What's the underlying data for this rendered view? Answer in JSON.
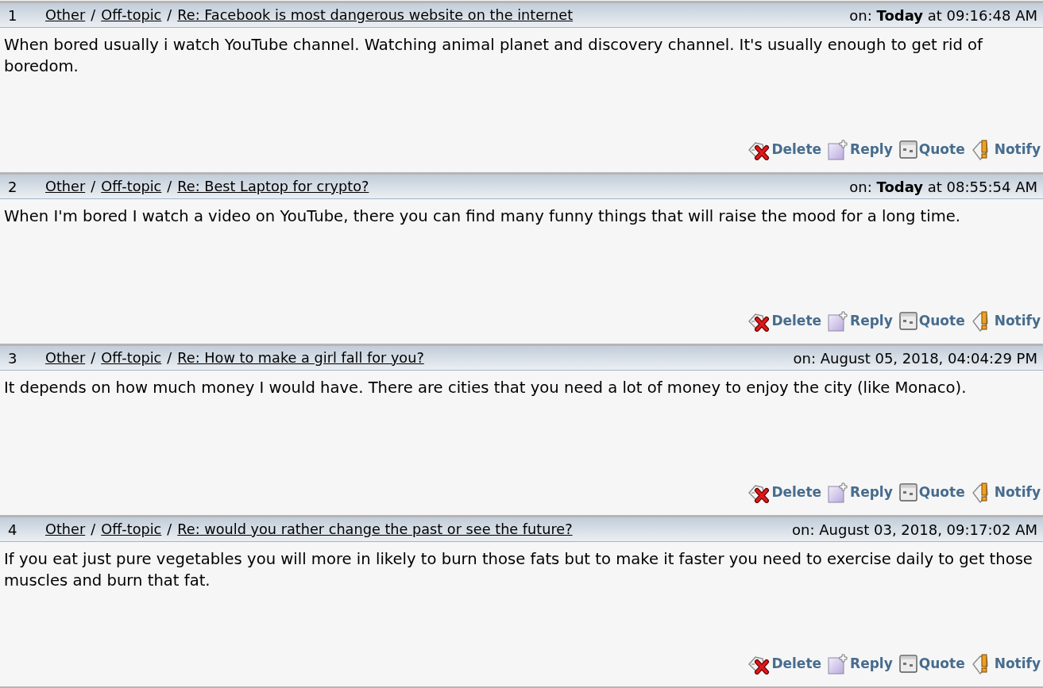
{
  "posts": [
    {
      "number": "1",
      "path": [
        {
          "kind": "link",
          "text": "Other"
        },
        {
          "kind": "separator",
          "text": "/"
        },
        {
          "kind": "link",
          "text": "Off-topic"
        },
        {
          "kind": "separator",
          "text": "/"
        },
        {
          "kind": "link",
          "text": "Re: Facebook is most dangerous website on the internet"
        }
      ],
      "date": "on: **Today** at 09:16:48 AM",
      "body": "When bored usually i watch YouTube channel. Watching animal planet and discovery channel. It's usually enough to get rid of boredom.",
      "actions": [
        {
          "kind": "delete",
          "label": "Delete"
        },
        {
          "kind": "reply",
          "label": "Reply"
        },
        {
          "kind": "quote",
          "label": "Quote"
        },
        {
          "kind": "notify",
          "label": "Notify"
        }
      ]
    },
    {
      "number": "2",
      "path": [
        {
          "kind": "link",
          "text": "Other"
        },
        {
          "kind": "separator",
          "text": "/"
        },
        {
          "kind": "link",
          "text": "Off-topic"
        },
        {
          "kind": "separator",
          "text": "/"
        },
        {
          "kind": "link",
          "text": "Re: Best Laptop for crypto?"
        }
      ],
      "date": "on: **Today** at 08:55:54 AM",
      "body": "When I'm bored I watch a video on YouTube, there you can find many funny things that will raise the mood for a long time.",
      "actions": [
        {
          "kind": "delete",
          "label": "Delete"
        },
        {
          "kind": "reply",
          "label": "Reply"
        },
        {
          "kind": "quote",
          "label": "Quote"
        },
        {
          "kind": "notify",
          "label": "Notify"
        }
      ]
    },
    {
      "number": "3",
      "path": [
        {
          "kind": "link",
          "text": "Other"
        },
        {
          "kind": "separator",
          "text": "/"
        },
        {
          "kind": "link",
          "text": "Off-topic"
        },
        {
          "kind": "separator",
          "text": "/"
        },
        {
          "kind": "link",
          "text": "Re: How to make a girl fall for you?"
        }
      ],
      "date": "on: August 05, 2018, 04:04:29 PM",
      "body": "It depends on how much money I would have. There are cities that you need a lot of money to enjoy the city (like Monaco).",
      "actions": [
        {
          "kind": "delete",
          "label": "Delete"
        },
        {
          "kind": "reply",
          "label": "Reply"
        },
        {
          "kind": "quote",
          "label": "Quote"
        },
        {
          "kind": "notify",
          "label": "Notify"
        }
      ]
    },
    {
      "number": "4",
      "path": [
        {
          "kind": "link",
          "text": "Other"
        },
        {
          "kind": "separator",
          "text": "/"
        },
        {
          "kind": "link",
          "text": "Off-topic"
        },
        {
          "kind": "separator",
          "text": "/"
        },
        {
          "kind": "link",
          "text": "Re: would you rather change the past or see the future?"
        }
      ],
      "date": "on: August 03, 2018, 09:17:02 AM",
      "body": "If you eat just pure vegetables you will more in likely to burn those fats but to make it faster you need to exercise daily to get those muscles and burn that fat.",
      "actions": [
        {
          "kind": "delete",
          "label": "Delete"
        },
        {
          "kind": "reply",
          "label": "Reply"
        },
        {
          "kind": "quote",
          "label": "Quote"
        },
        {
          "kind": "notify",
          "label": "Notify"
        }
      ]
    }
  ]
}
